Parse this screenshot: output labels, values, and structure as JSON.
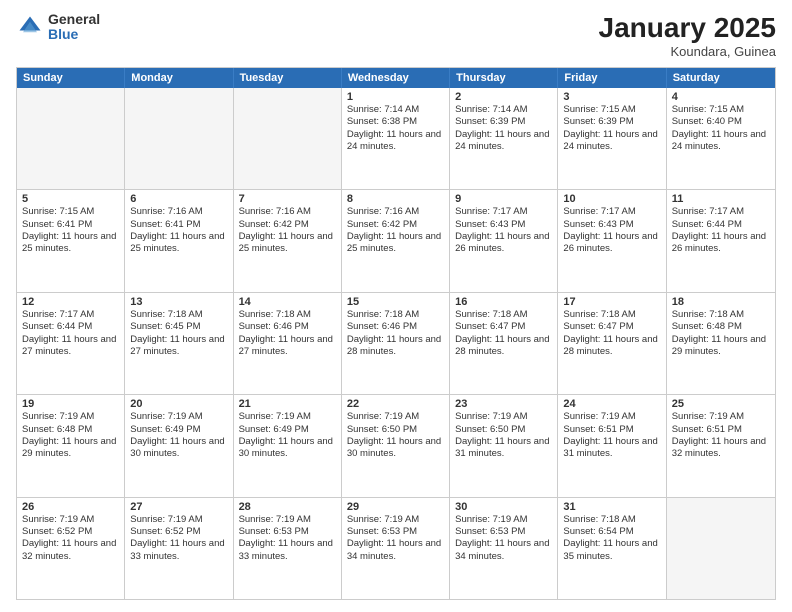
{
  "header": {
    "logo_general": "General",
    "logo_blue": "Blue",
    "month_title": "January 2025",
    "location": "Koundara, Guinea"
  },
  "days_of_week": [
    "Sunday",
    "Monday",
    "Tuesday",
    "Wednesday",
    "Thursday",
    "Friday",
    "Saturday"
  ],
  "rows": [
    [
      {
        "day": "",
        "empty": true
      },
      {
        "day": "",
        "empty": true
      },
      {
        "day": "",
        "empty": true
      },
      {
        "day": "1",
        "sunrise": "Sunrise: 7:14 AM",
        "sunset": "Sunset: 6:38 PM",
        "daylight": "Daylight: 11 hours and 24 minutes."
      },
      {
        "day": "2",
        "sunrise": "Sunrise: 7:14 AM",
        "sunset": "Sunset: 6:39 PM",
        "daylight": "Daylight: 11 hours and 24 minutes."
      },
      {
        "day": "3",
        "sunrise": "Sunrise: 7:15 AM",
        "sunset": "Sunset: 6:39 PM",
        "daylight": "Daylight: 11 hours and 24 minutes."
      },
      {
        "day": "4",
        "sunrise": "Sunrise: 7:15 AM",
        "sunset": "Sunset: 6:40 PM",
        "daylight": "Daylight: 11 hours and 24 minutes."
      }
    ],
    [
      {
        "day": "5",
        "sunrise": "Sunrise: 7:15 AM",
        "sunset": "Sunset: 6:41 PM",
        "daylight": "Daylight: 11 hours and 25 minutes."
      },
      {
        "day": "6",
        "sunrise": "Sunrise: 7:16 AM",
        "sunset": "Sunset: 6:41 PM",
        "daylight": "Daylight: 11 hours and 25 minutes."
      },
      {
        "day": "7",
        "sunrise": "Sunrise: 7:16 AM",
        "sunset": "Sunset: 6:42 PM",
        "daylight": "Daylight: 11 hours and 25 minutes."
      },
      {
        "day": "8",
        "sunrise": "Sunrise: 7:16 AM",
        "sunset": "Sunset: 6:42 PM",
        "daylight": "Daylight: 11 hours and 25 minutes."
      },
      {
        "day": "9",
        "sunrise": "Sunrise: 7:17 AM",
        "sunset": "Sunset: 6:43 PM",
        "daylight": "Daylight: 11 hours and 26 minutes."
      },
      {
        "day": "10",
        "sunrise": "Sunrise: 7:17 AM",
        "sunset": "Sunset: 6:43 PM",
        "daylight": "Daylight: 11 hours and 26 minutes."
      },
      {
        "day": "11",
        "sunrise": "Sunrise: 7:17 AM",
        "sunset": "Sunset: 6:44 PM",
        "daylight": "Daylight: 11 hours and 26 minutes."
      }
    ],
    [
      {
        "day": "12",
        "sunrise": "Sunrise: 7:17 AM",
        "sunset": "Sunset: 6:44 PM",
        "daylight": "Daylight: 11 hours and 27 minutes."
      },
      {
        "day": "13",
        "sunrise": "Sunrise: 7:18 AM",
        "sunset": "Sunset: 6:45 PM",
        "daylight": "Daylight: 11 hours and 27 minutes."
      },
      {
        "day": "14",
        "sunrise": "Sunrise: 7:18 AM",
        "sunset": "Sunset: 6:46 PM",
        "daylight": "Daylight: 11 hours and 27 minutes."
      },
      {
        "day": "15",
        "sunrise": "Sunrise: 7:18 AM",
        "sunset": "Sunset: 6:46 PM",
        "daylight": "Daylight: 11 hours and 28 minutes."
      },
      {
        "day": "16",
        "sunrise": "Sunrise: 7:18 AM",
        "sunset": "Sunset: 6:47 PM",
        "daylight": "Daylight: 11 hours and 28 minutes."
      },
      {
        "day": "17",
        "sunrise": "Sunrise: 7:18 AM",
        "sunset": "Sunset: 6:47 PM",
        "daylight": "Daylight: 11 hours and 28 minutes."
      },
      {
        "day": "18",
        "sunrise": "Sunrise: 7:18 AM",
        "sunset": "Sunset: 6:48 PM",
        "daylight": "Daylight: 11 hours and 29 minutes."
      }
    ],
    [
      {
        "day": "19",
        "sunrise": "Sunrise: 7:19 AM",
        "sunset": "Sunset: 6:48 PM",
        "daylight": "Daylight: 11 hours and 29 minutes."
      },
      {
        "day": "20",
        "sunrise": "Sunrise: 7:19 AM",
        "sunset": "Sunset: 6:49 PM",
        "daylight": "Daylight: 11 hours and 30 minutes."
      },
      {
        "day": "21",
        "sunrise": "Sunrise: 7:19 AM",
        "sunset": "Sunset: 6:49 PM",
        "daylight": "Daylight: 11 hours and 30 minutes."
      },
      {
        "day": "22",
        "sunrise": "Sunrise: 7:19 AM",
        "sunset": "Sunset: 6:50 PM",
        "daylight": "Daylight: 11 hours and 30 minutes."
      },
      {
        "day": "23",
        "sunrise": "Sunrise: 7:19 AM",
        "sunset": "Sunset: 6:50 PM",
        "daylight": "Daylight: 11 hours and 31 minutes."
      },
      {
        "day": "24",
        "sunrise": "Sunrise: 7:19 AM",
        "sunset": "Sunset: 6:51 PM",
        "daylight": "Daylight: 11 hours and 31 minutes."
      },
      {
        "day": "25",
        "sunrise": "Sunrise: 7:19 AM",
        "sunset": "Sunset: 6:51 PM",
        "daylight": "Daylight: 11 hours and 32 minutes."
      }
    ],
    [
      {
        "day": "26",
        "sunrise": "Sunrise: 7:19 AM",
        "sunset": "Sunset: 6:52 PM",
        "daylight": "Daylight: 11 hours and 32 minutes."
      },
      {
        "day": "27",
        "sunrise": "Sunrise: 7:19 AM",
        "sunset": "Sunset: 6:52 PM",
        "daylight": "Daylight: 11 hours and 33 minutes."
      },
      {
        "day": "28",
        "sunrise": "Sunrise: 7:19 AM",
        "sunset": "Sunset: 6:53 PM",
        "daylight": "Daylight: 11 hours and 33 minutes."
      },
      {
        "day": "29",
        "sunrise": "Sunrise: 7:19 AM",
        "sunset": "Sunset: 6:53 PM",
        "daylight": "Daylight: 11 hours and 34 minutes."
      },
      {
        "day": "30",
        "sunrise": "Sunrise: 7:19 AM",
        "sunset": "Sunset: 6:53 PM",
        "daylight": "Daylight: 11 hours and 34 minutes."
      },
      {
        "day": "31",
        "sunrise": "Sunrise: 7:18 AM",
        "sunset": "Sunset: 6:54 PM",
        "daylight": "Daylight: 11 hours and 35 minutes."
      },
      {
        "day": "",
        "empty": true
      }
    ]
  ]
}
